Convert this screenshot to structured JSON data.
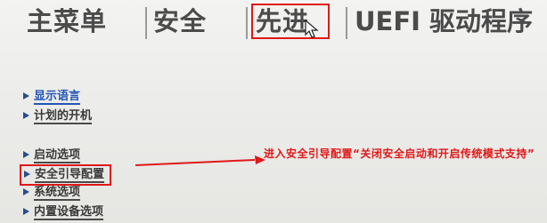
{
  "tabs": [
    {
      "label": "主菜单"
    },
    {
      "label": "安全"
    },
    {
      "label": "先进"
    },
    {
      "label": "UEFI 驱动程序"
    }
  ],
  "menu": {
    "items": [
      {
        "label": "显示语言"
      },
      {
        "label": "计划的开机"
      },
      {
        "label": "启动选项"
      },
      {
        "label": "安全引导配置"
      },
      {
        "label": "系统选项"
      },
      {
        "label": "内置设备选项"
      }
    ]
  },
  "annotation": {
    "text": "进入安全引导配置“关闭安全启动和开启传统模式支持”"
  },
  "colors": {
    "annotation_red": "#e01818",
    "active_blue": "#2455b5",
    "tab_text": "#4b4b4b"
  },
  "icons": [
    "arrow-icon",
    "mouse-cursor-icon",
    "annotation-arrow"
  ]
}
